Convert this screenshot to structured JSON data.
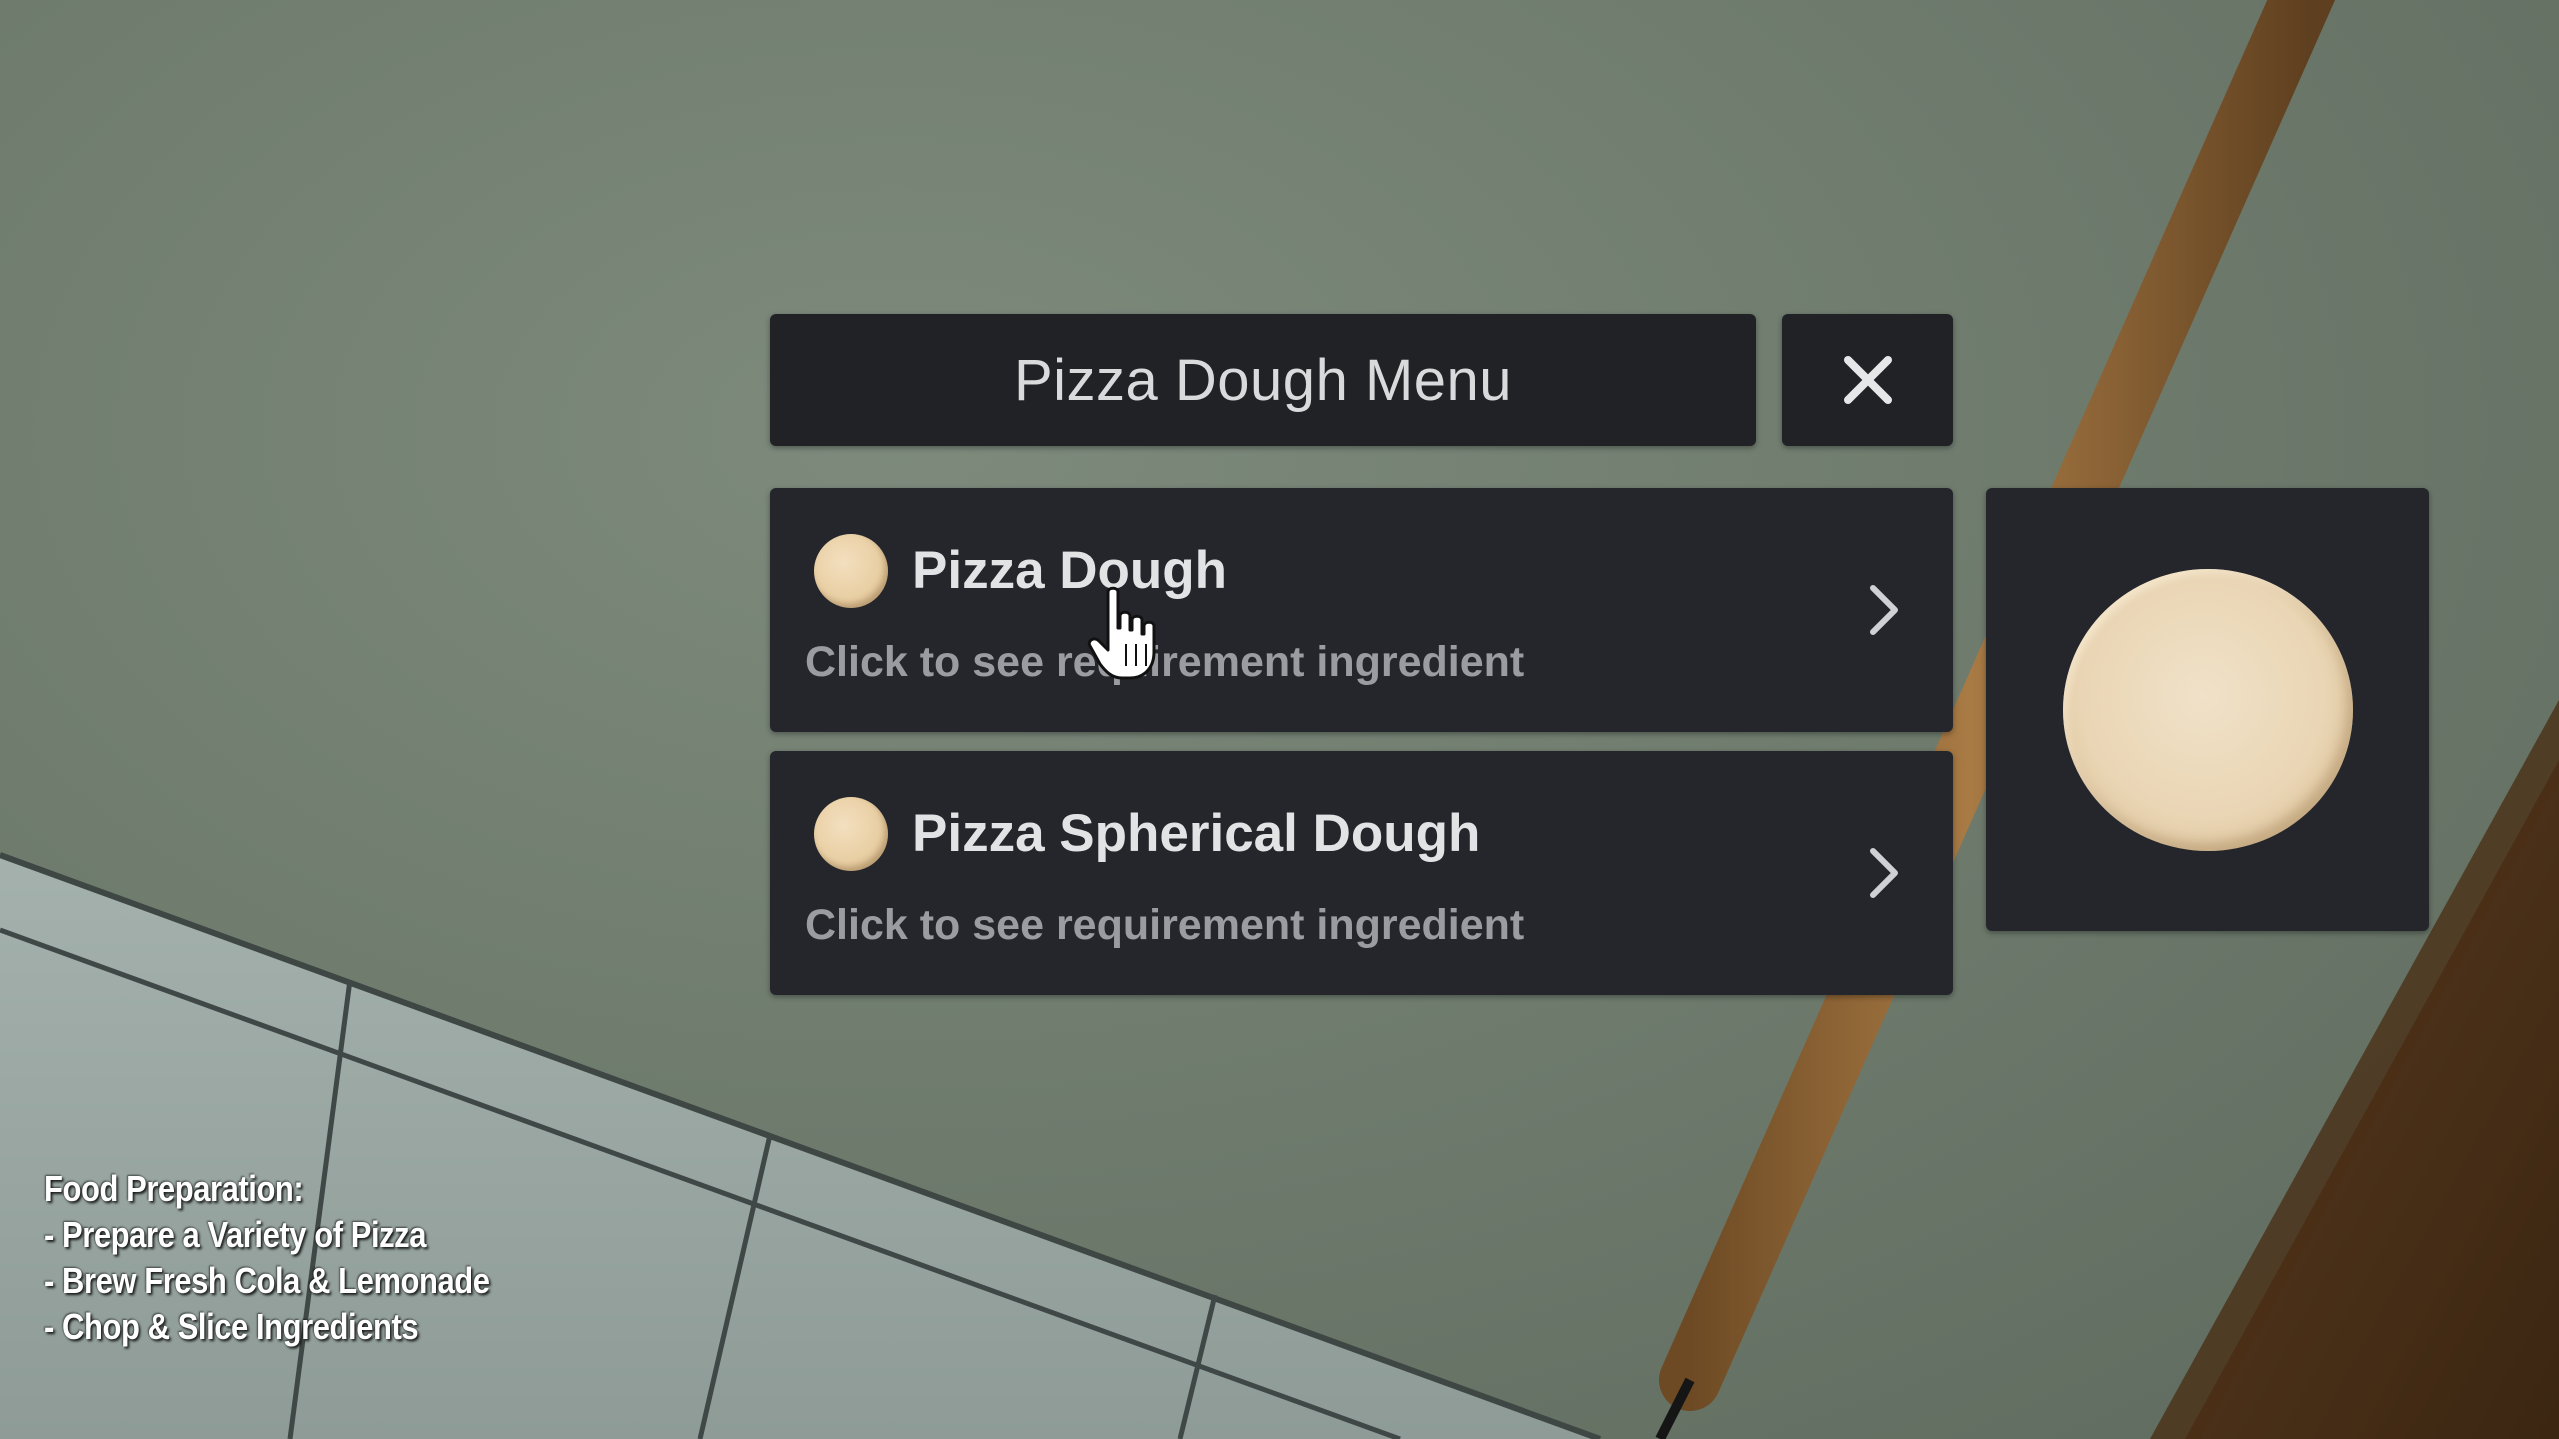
{
  "menu": {
    "title": "Pizza Dough Menu",
    "close_icon": "close-icon",
    "items": [
      {
        "title": "Pizza Dough",
        "subtitle": "Click to see requirement ingredient",
        "icon": "dough-icon"
      },
      {
        "title": "Pizza Spherical Dough",
        "subtitle": "Click to see requirement ingredient",
        "icon": "dough-ball-icon"
      }
    ],
    "preview_icon": "pizza-dough-image"
  },
  "overlay": {
    "heading": "Food Preparation:",
    "lines": [
      "- Prepare a Variety of Pizza",
      "- Brew Fresh Cola & Lemonade",
      "- Chop & Slice Ingredients"
    ]
  },
  "colors": {
    "panel_bg": "#25262b",
    "header_bg": "#212226",
    "title_text": "#d9dadc",
    "subtitle_text": "#9a9ca1",
    "wall": "#6f7c6e",
    "tile": "#9aa7a3",
    "rolling_pin": "#9a6c38"
  }
}
